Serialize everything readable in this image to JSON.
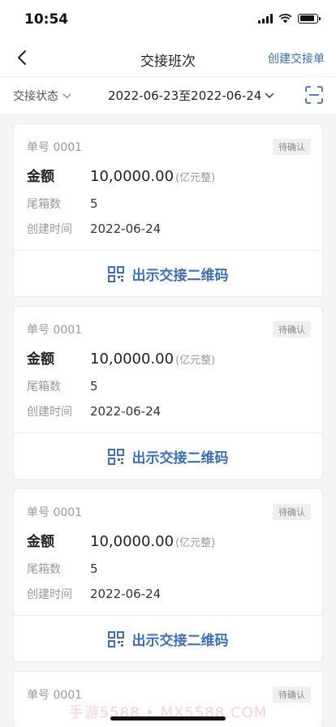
{
  "status": {
    "time": "10:54",
    "battery_level": 0.85
  },
  "nav": {
    "title": "交接班次",
    "action": "创建交接单",
    "back_icon": "chevron-left-icon"
  },
  "filter": {
    "status_label": "交接状态",
    "date_range": "2022-06-23至2022-06-24",
    "scan_icon": "scan-icon"
  },
  "labels": {
    "amount": "金额",
    "boxes": "尾箱数",
    "created": "创建时间",
    "qr_button": "出示交接二维码",
    "unit": "(亿元整)"
  },
  "cards": [
    {
      "number": "单号 0001",
      "status": "待确认",
      "amount": "10,0000.00",
      "boxes": "5",
      "created": "2022-06-24"
    },
    {
      "number": "单号 0001",
      "status": "待确认",
      "amount": "10,0000.00",
      "boxes": "5",
      "created": "2022-06-24"
    },
    {
      "number": "单号 0001",
      "status": "待确认",
      "amount": "10,0000.00",
      "boxes": "5",
      "created": "2022-06-24"
    },
    {
      "number": "单号 0001",
      "status": "待确认"
    }
  ],
  "watermark": "手游5588 • MX5588.COM",
  "colors": {
    "accent": "#3a6fc4",
    "background": "#f4f5f7"
  }
}
